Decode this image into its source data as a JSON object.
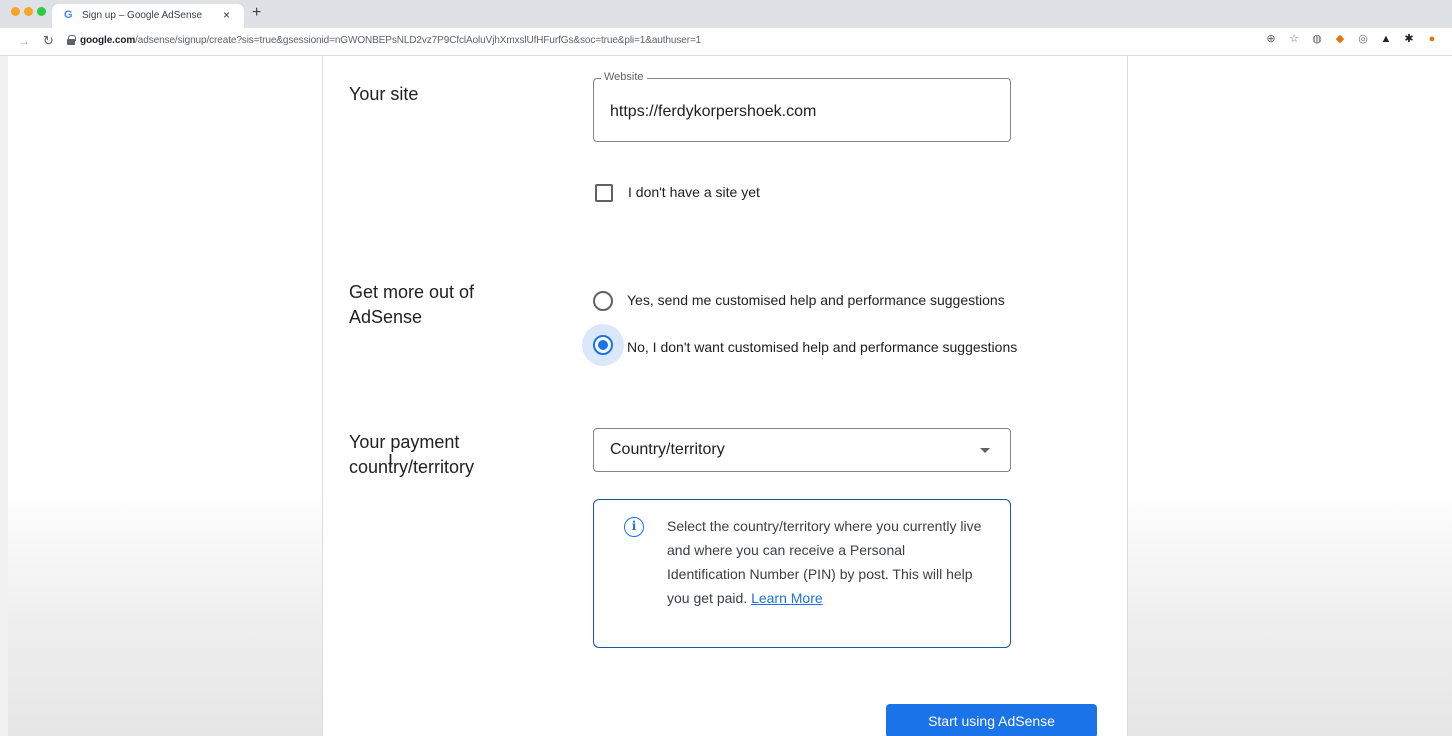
{
  "browser": {
    "tab_title": "Sign up – Google AdSense",
    "tab_favicon": "G",
    "tab_close": "×",
    "new_tab": "+",
    "url_host": "google.com",
    "url_path": "/adsense/signup/create?sis=true&gsessionid=nGWONBEPsNLD2vz7P9CfclAoluVjhXmxslUfHFurfGs&soc=true&pli=1&authuser=1",
    "extension_icons": [
      "zoom-icon",
      "star-icon",
      "extension-icon-1",
      "extension-icon-2",
      "extension-icon-3",
      "extension-icon-4",
      "puzzle-icon",
      "profile-icon"
    ]
  },
  "form": {
    "site": {
      "label": "Your site",
      "field_legend": "Website",
      "field_value": "https://ferdykorpershoek.com",
      "no_site_checkbox_label": "I don't have a site yet",
      "no_site_checked": false
    },
    "adsense_help": {
      "label_line1": "Get more out of",
      "label_line2": "AdSense",
      "option_yes": "Yes, send me customised help and performance suggestions",
      "option_no": "No, I don't want customised help and performance suggestions",
      "selected": "no"
    },
    "payment_country": {
      "label_line1": "Your payment",
      "label_line2": "country/territory",
      "select_value": "Country/territory",
      "info_text": "Select the country/territory where you currently live and where you can receive a Personal Identification Number (PIN) by post. This will help you get paid.",
      "info_link": "Learn More"
    },
    "submit_label": "Start using AdSense"
  },
  "colors": {
    "accent": "#1a73e8",
    "info_border": "#1a56a8",
    "text": "#202124"
  }
}
